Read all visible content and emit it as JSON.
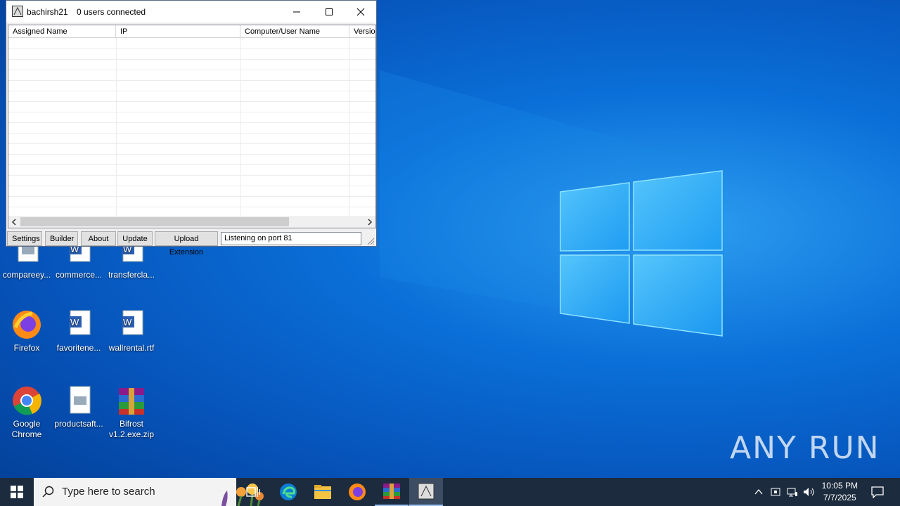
{
  "window": {
    "title": "bachirsh21",
    "connection_status": "0 users connected",
    "columns": [
      "Assigned Name",
      "IP",
      "Computer/User Name",
      "Versio"
    ],
    "buttons": [
      "Settings",
      "Builder",
      "About",
      "Update",
      "Upload Extension"
    ],
    "status_text": "Listening on port 81"
  },
  "desktop": {
    "icons": [
      {
        "label": "compareey...",
        "icon": "image-file-icon"
      },
      {
        "label": "commerce...",
        "icon": "word-doc-icon"
      },
      {
        "label": "transfercla...",
        "icon": "word-doc-icon"
      },
      {
        "label": "Firefox",
        "icon": "firefox-icon"
      },
      {
        "label": "favoritene...",
        "icon": "word-doc-icon"
      },
      {
        "label": "wallrental.rtf",
        "icon": "word-doc-icon"
      },
      {
        "label": "Google Chrome",
        "icon": "chrome-icon"
      },
      {
        "label": "productsaft...",
        "icon": "image-file-icon"
      },
      {
        "label": "Bifrost v1.2.exe.zip",
        "icon": "winrar-icon"
      }
    ]
  },
  "taskbar": {
    "search_placeholder": "Type here to search",
    "time": "10:05 PM",
    "date": "7/7/2025"
  },
  "watermark": "ANY RUN"
}
